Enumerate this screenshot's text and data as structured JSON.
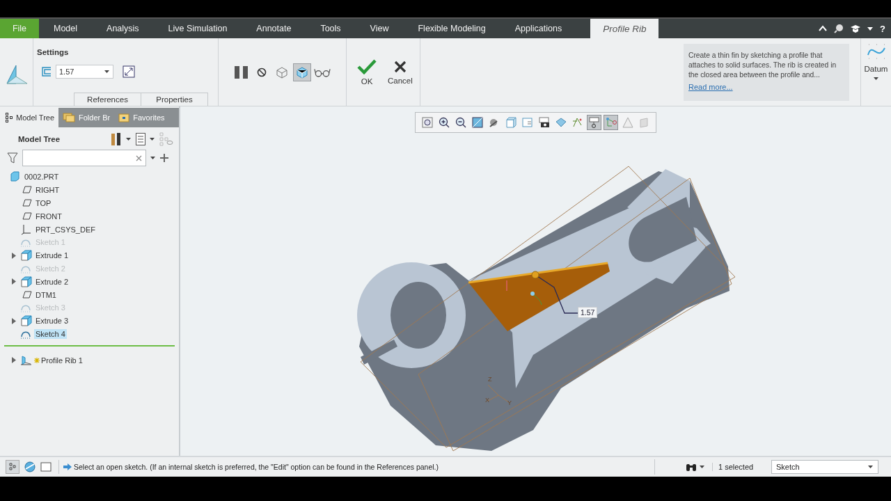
{
  "window_tabs": [
    {
      "label": "File",
      "kind": "file",
      "selected": false
    },
    {
      "label": "Model",
      "kind": "normal",
      "selected": false
    },
    {
      "label": "Analysis",
      "kind": "normal",
      "selected": false
    },
    {
      "label": "Live Simulation",
      "kind": "normal",
      "selected": false
    },
    {
      "label": "Annotate",
      "kind": "normal",
      "selected": false
    },
    {
      "label": "Tools",
      "kind": "normal",
      "selected": false
    },
    {
      "label": "View",
      "kind": "normal",
      "selected": false
    },
    {
      "label": "Flexible Modeling",
      "kind": "normal",
      "selected": false
    },
    {
      "label": "Applications",
      "kind": "normal",
      "selected": false
    },
    {
      "label": "Profile Rib",
      "kind": "contextual",
      "selected": true
    }
  ],
  "header_help": "?",
  "ribbon": {
    "group_title": "Settings",
    "thickness": "1.57",
    "panel_tabs": [
      {
        "label": "References",
        "selected": false
      },
      {
        "label": "Properties",
        "selected": false
      }
    ],
    "tools": [
      {
        "kind": "pause",
        "on": false
      },
      {
        "kind": "no-geometry",
        "on": false
      },
      {
        "kind": "verify",
        "on": false
      },
      {
        "kind": "preview",
        "on": true
      },
      {
        "kind": "glasses",
        "on": false
      }
    ],
    "ok": "OK",
    "cancel": "Cancel",
    "help_text": "Create a thin fin by sketching a profile that attaches to solid surfaces. The rib is created in the closed area between the profile and...",
    "read_more": "Read more...",
    "datum": "Datum"
  },
  "navigator": {
    "tabs": [
      {
        "label": "Model Tree",
        "kind": "tree",
        "selected": true
      },
      {
        "label": "Folder Br",
        "kind": "folder",
        "selected": false
      },
      {
        "label": "Favorites",
        "kind": "favorites",
        "selected": false
      }
    ],
    "title": "Model Tree",
    "tree": [
      {
        "label": "0002.PRT",
        "kind": "part",
        "selected": false,
        "disabled": false,
        "children": [
          {
            "label": "RIGHT",
            "kind": "plane",
            "selected": false,
            "disabled": false
          },
          {
            "label": "TOP",
            "kind": "plane",
            "selected": false,
            "disabled": false
          },
          {
            "label": "FRONT",
            "kind": "plane",
            "selected": false,
            "disabled": false
          },
          {
            "label": "PRT_CSYS_DEF",
            "kind": "csys",
            "selected": false,
            "disabled": false
          },
          {
            "label": "Sketch 1",
            "kind": "sketch",
            "selected": false,
            "disabled": true
          },
          {
            "label": "Extrude 1",
            "kind": "extrude",
            "selected": false,
            "disabled": false,
            "expanded": false
          },
          {
            "label": "Sketch 2",
            "kind": "sketch",
            "selected": false,
            "disabled": true
          },
          {
            "label": "Extrude 2",
            "kind": "extrude",
            "selected": false,
            "disabled": false,
            "expanded": false
          },
          {
            "label": "DTM1",
            "kind": "plane",
            "selected": false,
            "disabled": false
          },
          {
            "label": "Sketch 3",
            "kind": "sketch",
            "selected": false,
            "disabled": true
          },
          {
            "label": "Extrude 3",
            "kind": "extrude",
            "selected": false,
            "disabled": false,
            "expanded": false
          },
          {
            "label": "Sketch 4",
            "kind": "sketch",
            "selected": true,
            "disabled": false
          },
          {
            "kind": "insert-here"
          },
          {
            "label": "Profile Rib 1",
            "kind": "rib",
            "selected": false,
            "disabled": false,
            "expanded": false,
            "new": true
          }
        ]
      }
    ]
  },
  "view_tools": [
    {
      "kind": "refit",
      "on": false
    },
    {
      "kind": "zoom-in",
      "on": false
    },
    {
      "kind": "zoom-out",
      "on": false
    },
    {
      "kind": "repaint",
      "on": false
    },
    {
      "kind": "display-style",
      "on": false
    },
    {
      "kind": "saved-views",
      "on": false
    },
    {
      "kind": "view-manager",
      "on": false
    },
    {
      "kind": "perspective",
      "on": false
    },
    {
      "kind": "spin",
      "on": false
    },
    {
      "kind": "datum-display",
      "on": false
    },
    {
      "kind": "annotation",
      "on": true
    },
    {
      "kind": "sketch-display",
      "on": true
    },
    {
      "kind": "analysis",
      "on": false
    },
    {
      "kind": "section",
      "on": false
    }
  ],
  "viewport": {
    "dimension": "1.57",
    "axes": [
      {
        "label": "Z",
        "kind": "z"
      },
      {
        "label": "X",
        "kind": "x"
      },
      {
        "label": "Y",
        "kind": "y"
      }
    ]
  },
  "status_bar": {
    "message": "Select an open sketch. (If an internal sketch is preferred, the \"Edit\" option can be found in the References panel.)",
    "selection_count": "1 selected",
    "filter": "Sketch"
  }
}
